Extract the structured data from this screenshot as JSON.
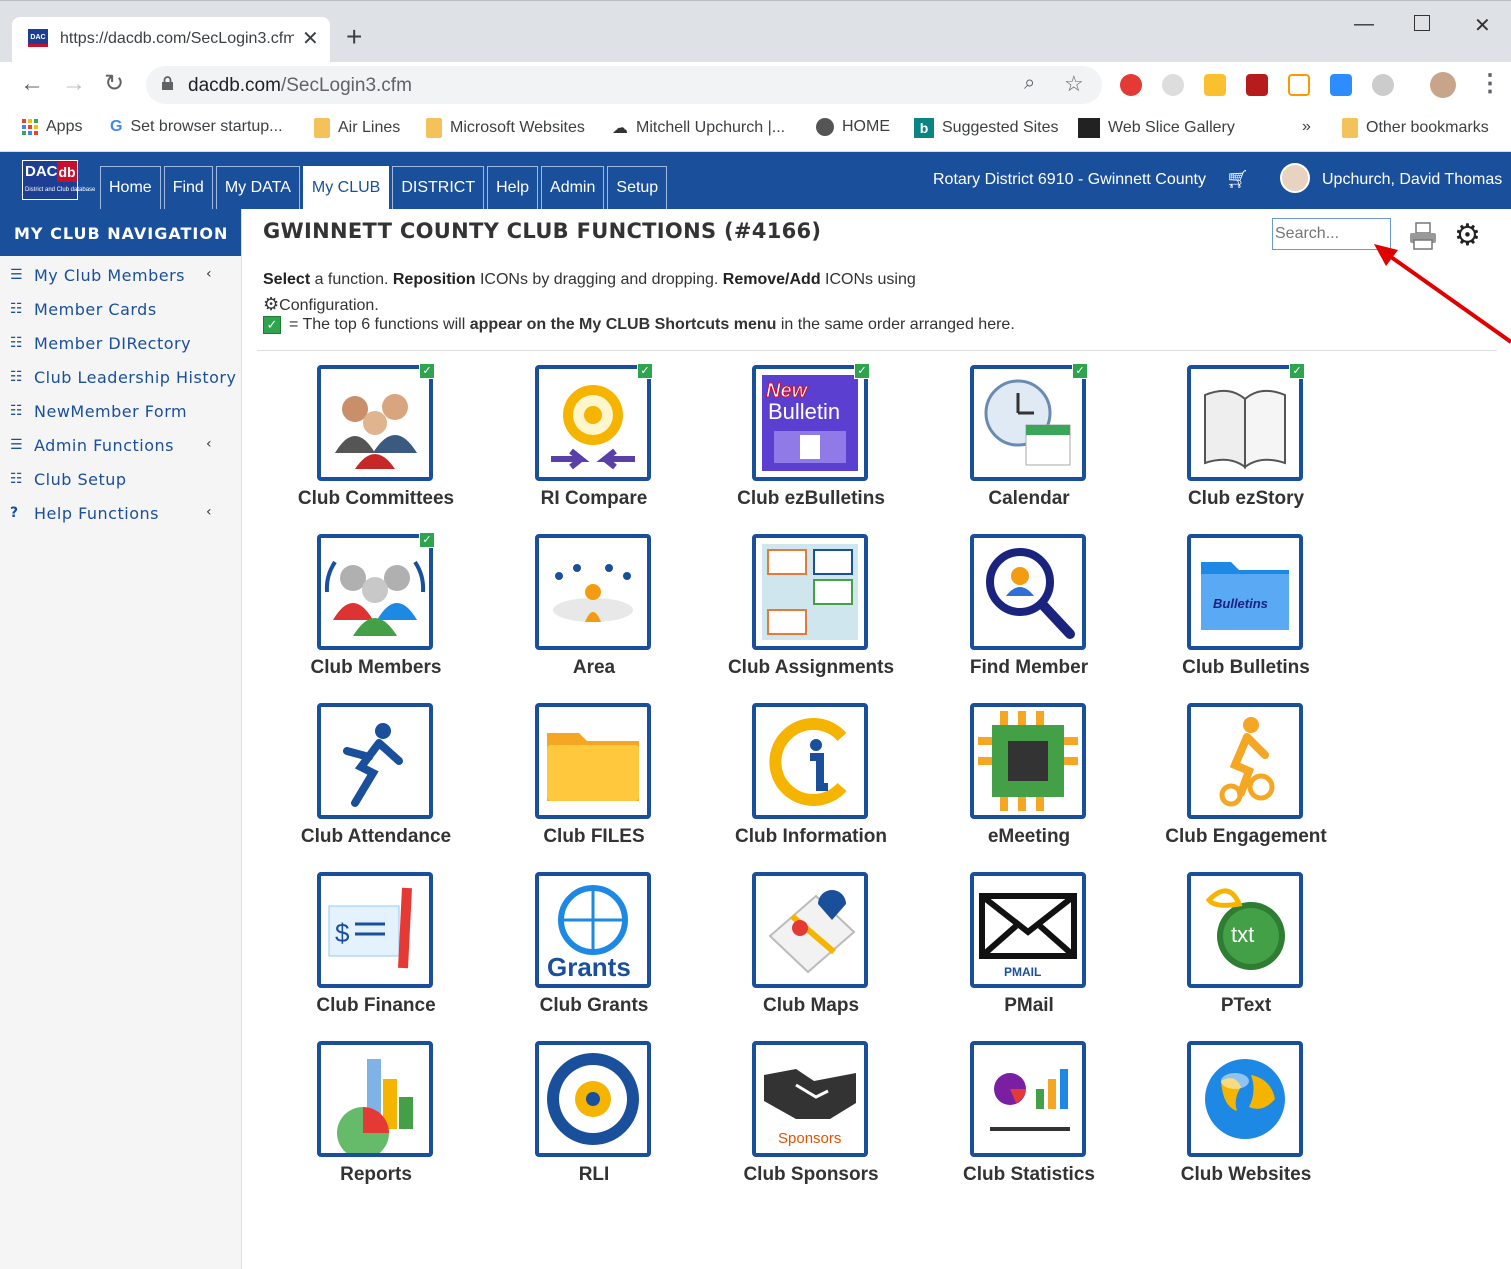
{
  "browser": {
    "tab_title": "https://dacdb.com/SecLogin3.cfm",
    "url_domain": "dacdb.com",
    "url_path": "/SecLogin3.cfm",
    "bookmarks": [
      {
        "label": "Apps",
        "icon": "apps-grid-icon"
      },
      {
        "label": "Set browser startup...",
        "icon": "google-icon"
      },
      {
        "label": "Air Lines",
        "icon": "folder-icon"
      },
      {
        "label": "Microsoft Websites",
        "icon": "folder-icon"
      },
      {
        "label": "Mitchell Upchurch |...",
        "icon": "bookmark-icon"
      },
      {
        "label": "HOME",
        "icon": "globe-icon"
      },
      {
        "label": "Suggested Sites",
        "icon": "bing-icon"
      },
      {
        "label": "Web Slice Gallery",
        "icon": "slice-icon"
      }
    ],
    "overflow_label": "»",
    "other_bookmarks": "Other bookmarks"
  },
  "site": {
    "logo": "DAC db",
    "logo_tagline": "District and Club database",
    "nav": [
      "Home",
      "Find",
      "My DATA",
      "My CLUB",
      "DISTRICT",
      "Help",
      "Admin",
      "Setup"
    ],
    "active_nav": "My CLUB",
    "district": "Rotary District 6910 - Gwinnett County",
    "user": "Upchurch, David Thomas"
  },
  "sidebar": {
    "heading": "MY CLUB NAVIGATION",
    "items": [
      {
        "label": "My Club Members",
        "icon": "menu-icon",
        "expandable": true
      },
      {
        "label": "Member Cards",
        "icon": "list-icon",
        "expandable": false
      },
      {
        "label": "Member DIRectory",
        "icon": "list-icon",
        "expandable": false
      },
      {
        "label": "Club Leadership History",
        "icon": "list-icon",
        "expandable": false
      },
      {
        "label": "NewMember Form",
        "icon": "list-icon",
        "expandable": false
      },
      {
        "label": "Admin Functions",
        "icon": "menu-icon",
        "expandable": true
      },
      {
        "label": "Club Setup",
        "icon": "list-icon",
        "expandable": false
      },
      {
        "label": "Help Functions",
        "icon": "question-icon",
        "expandable": true
      }
    ]
  },
  "main": {
    "title": "GWINNETT COUNTY CLUB FUNCTIONS (#4166)",
    "search_placeholder": "Search...",
    "intro": {
      "select_bold": "Select",
      "select_text": " a function. ",
      "reposition_bold": "Reposition",
      "reposition_text": " ICONs by dragging and dropping. ",
      "removeadd_bold": "Remove/Add",
      "removeadd_text": " ICONs using",
      "config_text": "Configuration."
    },
    "shortcut_note": {
      "prefix": "= The top 6 functions will ",
      "bold": "appear on the My CLUB Shortcuts menu",
      "suffix": " in the same order arranged here."
    },
    "functions": [
      {
        "label": "Club Committees",
        "icon": "committees-icon",
        "shortcut": true
      },
      {
        "label": "RI Compare",
        "icon": "rotary-wheel-icon",
        "shortcut": true
      },
      {
        "label": "Club ezBulletins",
        "icon": "bulletin-icon",
        "shortcut": true,
        "badge": "New",
        "title": "Bulletin"
      },
      {
        "label": "Calendar",
        "icon": "calendar-clock-icon",
        "shortcut": true
      },
      {
        "label": "Club ezStory",
        "icon": "book-icon",
        "shortcut": true
      },
      {
        "label": "Club Members",
        "icon": "members-icon",
        "shortcut": true
      },
      {
        "label": "Area",
        "icon": "area-people-icon",
        "shortcut": false
      },
      {
        "label": "Club Assignments",
        "icon": "assignments-icon",
        "shortcut": false
      },
      {
        "label": "Find Member",
        "icon": "find-member-icon",
        "shortcut": false
      },
      {
        "label": "Club Bulletins",
        "icon": "bulletins-folder-icon",
        "shortcut": false,
        "title": "Bulletins"
      },
      {
        "label": "Club Attendance",
        "icon": "attendance-icon",
        "shortcut": false
      },
      {
        "label": "Club FILES",
        "icon": "folder-icon",
        "shortcut": false
      },
      {
        "label": "Club Information",
        "icon": "information-icon",
        "shortcut": false
      },
      {
        "label": "eMeeting",
        "icon": "chip-icon",
        "shortcut": false
      },
      {
        "label": "Club Engagement",
        "icon": "engagement-icon",
        "shortcut": false
      },
      {
        "label": "Club Finance",
        "icon": "check-pen-icon",
        "shortcut": false
      },
      {
        "label": "Club Grants",
        "icon": "grants-globe-icon",
        "shortcut": false,
        "title": "Grants"
      },
      {
        "label": "Club Maps",
        "icon": "map-pin-icon",
        "shortcut": false
      },
      {
        "label": "PMail",
        "icon": "envelope-icon",
        "shortcut": false,
        "title": "PMAIL"
      },
      {
        "label": "PText",
        "icon": "ptext-icon",
        "shortcut": false,
        "title": "txt"
      },
      {
        "label": "Reports",
        "icon": "reports-chart-icon",
        "shortcut": false
      },
      {
        "label": "RLI",
        "icon": "rli-seal-icon",
        "shortcut": false
      },
      {
        "label": "Club Sponsors",
        "icon": "handshake-icon",
        "shortcut": false,
        "title": "Sponsors"
      },
      {
        "label": "Club Statistics",
        "icon": "statistics-icon",
        "shortcut": false
      },
      {
        "label": "Club Websites",
        "icon": "globe-icon",
        "shortcut": false
      }
    ]
  },
  "colors": {
    "brand_blue": "#1a4f9c",
    "shortcut_green": "#2ea44f",
    "annotation_red": "#e00000"
  }
}
